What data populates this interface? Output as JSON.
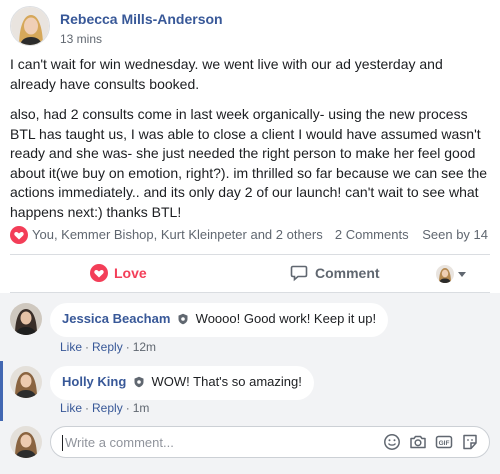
{
  "post": {
    "author": "Rebecca Mills-Anderson",
    "time": "13 mins",
    "paragraphs": [
      "I can't wait for win wednesday. we went live with our ad yesterday and already have consults booked.",
      "also, had 2 consults come in last week organically- using the new process BTL has taught us, I was able to close a client I would have assumed wasn't ready and she was- she just needed the right person to make her feel good about it(we buy on emotion, right?). im thrilled so far because we can see the actions immediately.. and its only day 2 of our launch! can't wait to see what happens next:) thanks BTL!"
    ]
  },
  "reactions": {
    "names": "You, Kemmer Bishop, Kurt Kleinpeter and 2 others",
    "comments": "2 Comments",
    "seen": "Seen by 14"
  },
  "actions": {
    "love": "Love",
    "comment": "Comment"
  },
  "comments": [
    {
      "name": "Jessica Beacham",
      "text": "Woooo! Good work! Keep it up!",
      "like": "Like",
      "reply": "Reply",
      "time": "12m"
    },
    {
      "name": "Holly King",
      "text": "WOW! That's so amazing!",
      "like": "Like",
      "reply": "Reply",
      "time": "1m"
    }
  ],
  "composer": {
    "placeholder": "Write a comment..."
  },
  "icons": {
    "reaction": "heart-icon",
    "love": "heart-icon",
    "comment": "speech-bubble-icon",
    "badge": "shield-badge-icon",
    "composer": [
      "emoji-icon",
      "camera-icon",
      "gif-icon",
      "sticker-icon"
    ]
  },
  "colors": {
    "link": "#385898",
    "love": "#f33e58",
    "muted": "#606770",
    "comments_bg": "#f2f3f5"
  }
}
